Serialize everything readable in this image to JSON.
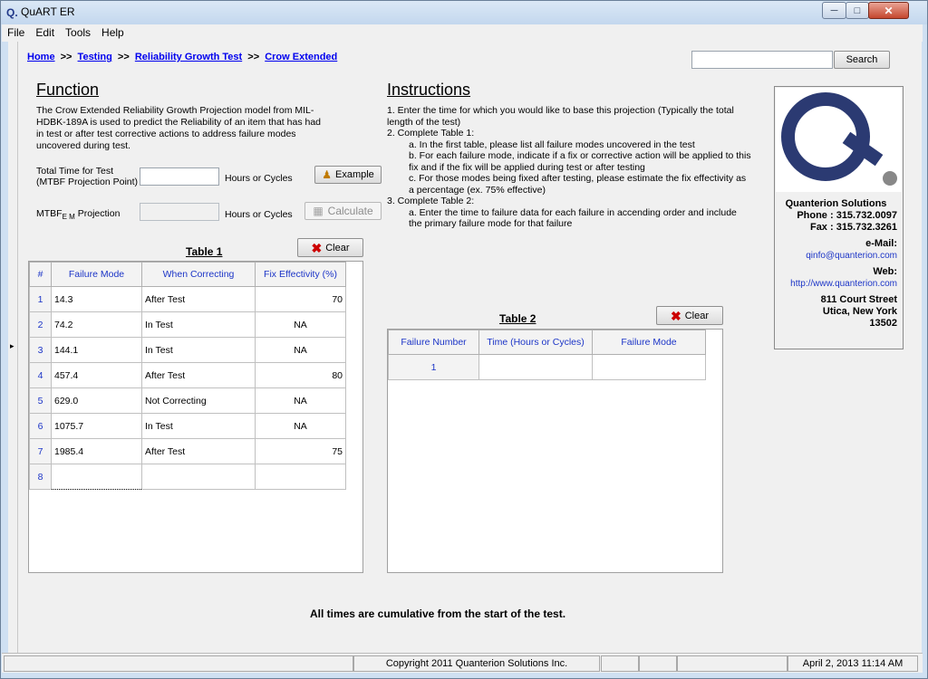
{
  "window": {
    "title": "QuART ER",
    "app_icon": "Q."
  },
  "menu": [
    "File",
    "Edit",
    "Tools",
    "Help"
  ],
  "breadcrumb": {
    "items": [
      "Home",
      "Testing",
      "Reliability Growth Test",
      "Crow Extended"
    ],
    "separator": ">>"
  },
  "search": {
    "value": "",
    "button_label": "Search"
  },
  "function": {
    "title": "Function",
    "description": "The Crow Extended Reliability Growth Projection model from MIL-HDBK-189A is used to predict the Reliability of an item that has had in test or after test corrective actions to address failure modes uncovered during test.",
    "total_time_label_1": "Total Time for Test",
    "total_time_label_2": "(MTBF Projection Point)",
    "total_time_value": "",
    "units_label": "Hours or Cycles",
    "example_label": "Example",
    "mtbf_label": "MTBF",
    "mtbf_sub": "E M",
    "mtbf_suffix": "Projection",
    "mtbf_value": "",
    "calculate_label": "Calculate"
  },
  "instructions": {
    "title": "Instructions",
    "line_1": "1. Enter the time for which you would like to base this projection (Typically the total length of the test)",
    "line_2": "2. Complete Table 1:",
    "line_2a": "a. In the first table, please list all failure modes uncovered in the test",
    "line_2b": "b. For each failure mode, indicate if a fix or corrective action will be applied to this fix and if the fix will be applied during test or after testing",
    "line_2c": "c. For those modes being fixed after testing, please estimate the fix effectivity as a percentage (ex. 75% effective)",
    "line_3": "3. Complete Table 2:",
    "line_3a": "a. Enter the time to failure data for each failure in accending order and include the primary failure mode for that failure"
  },
  "table1": {
    "title": "Table 1",
    "clear_label": "Clear",
    "headers": [
      "#",
      "Failure Mode",
      "When Correcting",
      "Fix Effectivity (%)"
    ],
    "rows": [
      {
        "num": "1",
        "mode": "14.3",
        "when": "After Test",
        "fix": "70"
      },
      {
        "num": "2",
        "mode": "74.2",
        "when": "In Test",
        "fix": "NA"
      },
      {
        "num": "3",
        "mode": "144.1",
        "when": "In Test",
        "fix": "NA"
      },
      {
        "num": "4",
        "mode": "457.4",
        "when": "After Test",
        "fix": "80"
      },
      {
        "num": "5",
        "mode": "629.0",
        "when": "Not Correcting",
        "fix": "NA"
      },
      {
        "num": "6",
        "mode": "1075.7",
        "when": "In Test",
        "fix": "NA"
      },
      {
        "num": "7",
        "mode": "1985.4",
        "when": "After Test",
        "fix": "75"
      },
      {
        "num": "8",
        "mode": "",
        "when": "",
        "fix": ""
      }
    ]
  },
  "table2": {
    "title": "Table 2",
    "clear_label": "Clear",
    "headers": [
      "Failure Number",
      "Time (Hours or Cycles)",
      "Failure Mode"
    ],
    "rows": [
      {
        "num": "1",
        "time": "",
        "mode": ""
      }
    ]
  },
  "contact": {
    "company": "Quanterion Solutions",
    "phone": "Phone : 315.732.0097",
    "fax": "Fax : 315.732.3261",
    "email_label": "e-Mail:",
    "email": "qinfo@quanterion.com",
    "web_label": "Web:",
    "web": "http://www.quanterion.com",
    "street": "811 Court Street",
    "city": "Utica, New York",
    "zip": "13502"
  },
  "footnote": "All times are cumulative from the start of the test.",
  "status": {
    "copyright": "Copyright 2011 Quanterion Solutions Inc.",
    "datetime": "April 2, 2013  11:14 AM"
  },
  "colors": {
    "link": "#0000ee",
    "grid_header_text": "#1c35c7",
    "logo": "#2b3a72",
    "clear_x": "#cc0000"
  }
}
